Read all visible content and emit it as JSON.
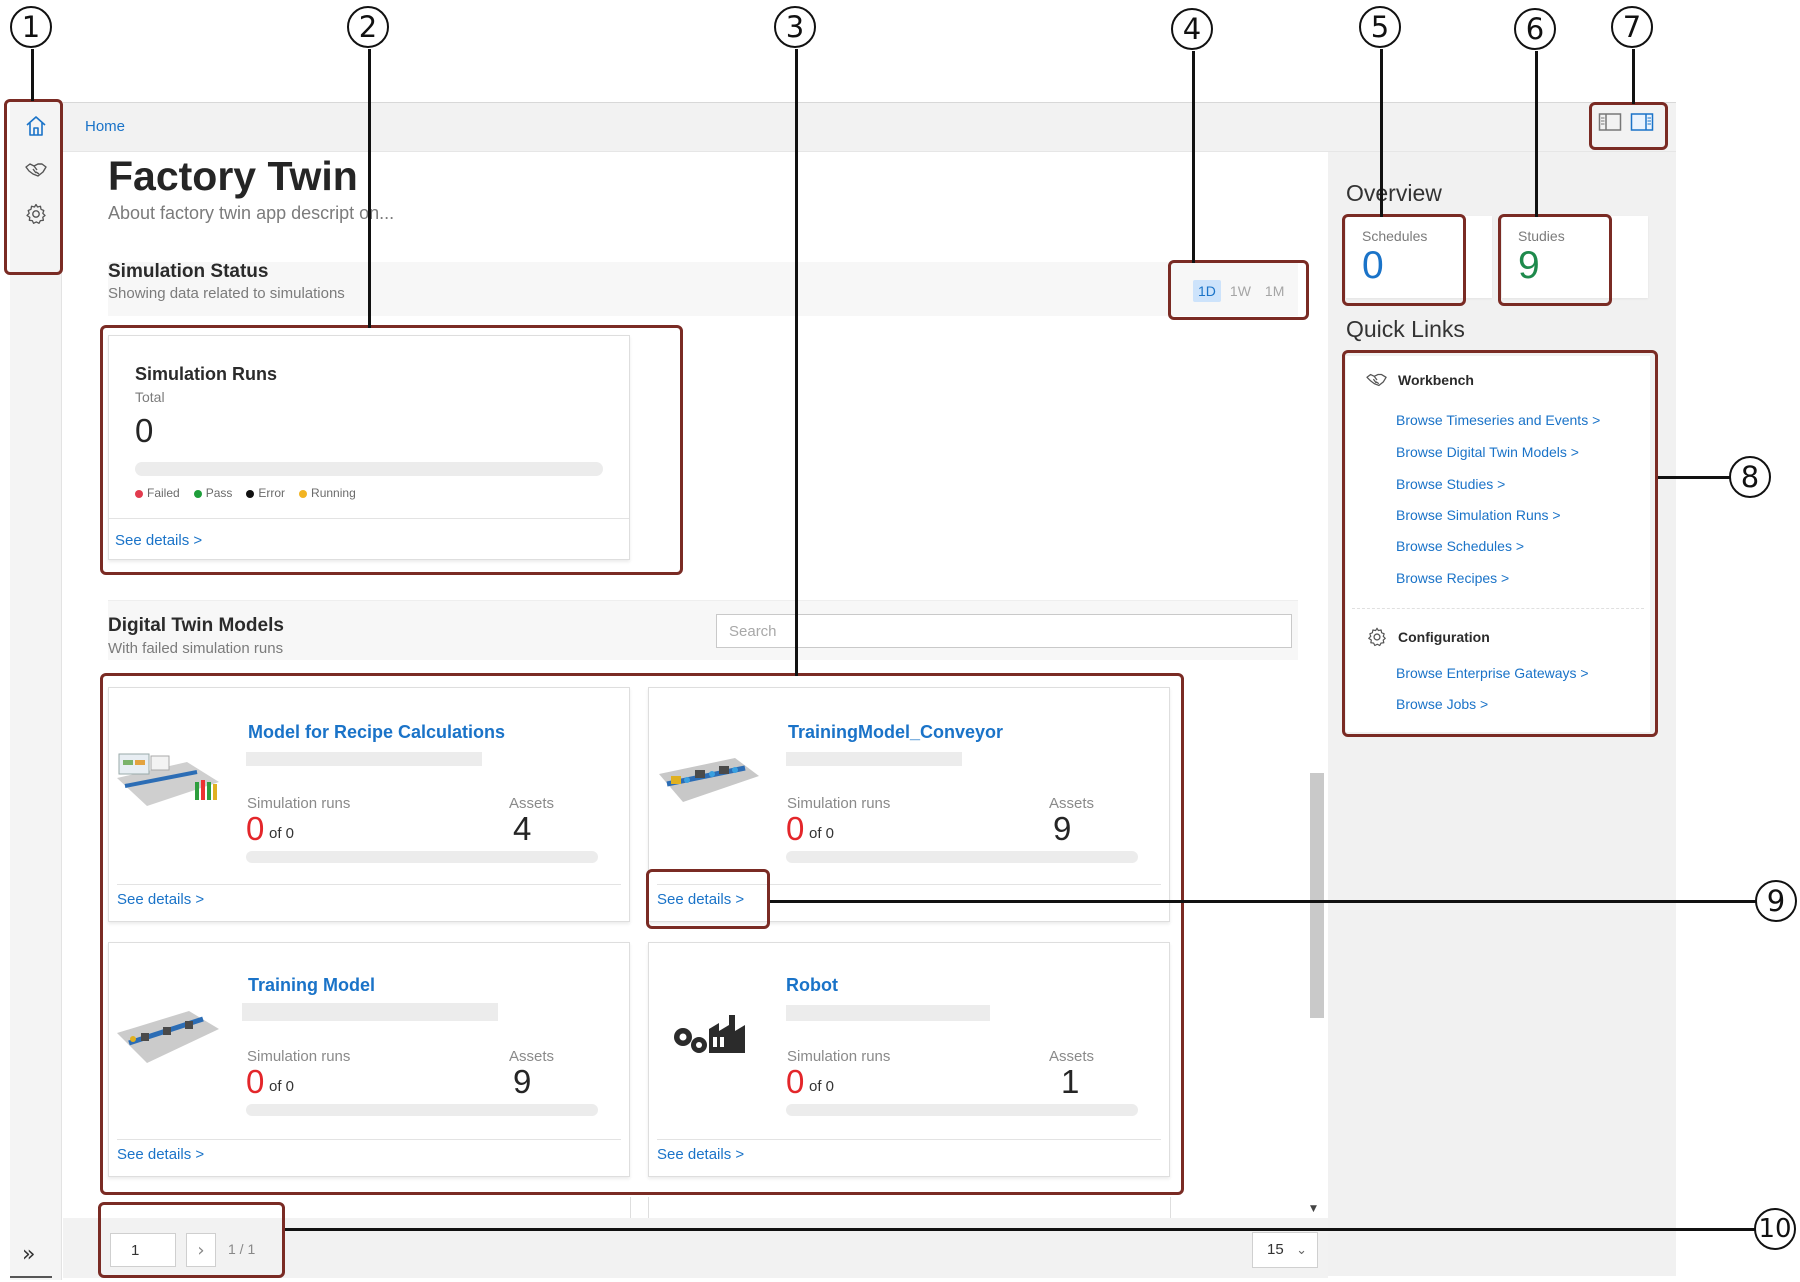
{
  "breadcrumb": {
    "home": "Home"
  },
  "page": {
    "title": "Factory Twin",
    "description": "About factory twin app descript on..."
  },
  "simulation_status": {
    "title": "Simulation Status",
    "subtitle": "Showing data related to simulations",
    "ranges": [
      "1D",
      "1W",
      "1M"
    ],
    "active_range": "1D"
  },
  "simulation_runs": {
    "title": "Simulation Runs",
    "label": "Total",
    "value": "0",
    "legend": [
      "Failed",
      "Pass",
      "Error",
      "Running"
    ],
    "legend_colors": [
      "#e23b4e",
      "#1e9e3a",
      "#111111",
      "#f2b422"
    ],
    "see_details": "See details >"
  },
  "models_section": {
    "title": "Digital Twin Models",
    "subtitle": "With failed simulation runs",
    "search_placeholder": "Search"
  },
  "models": [
    {
      "name": "Model for Recipe Calculations",
      "runs_label": "Simulation runs",
      "runs_failed": "0",
      "runs_total": "of 0",
      "assets_label": "Assets",
      "assets": "4",
      "see_details": "See details >",
      "thumb": "factory-line-screens-icon"
    },
    {
      "name": "TrainingModel_Conveyor",
      "runs_label": "Simulation runs",
      "runs_failed": "0",
      "runs_total": "of 0",
      "assets_label": "Assets",
      "assets": "9",
      "see_details": "See details >",
      "thumb": "conveyor-line-icon"
    },
    {
      "name": "Training Model",
      "runs_label": "Simulation runs",
      "runs_failed": "0",
      "runs_total": "of 0",
      "assets_label": "Assets",
      "assets": "9",
      "see_details": "See details >",
      "thumb": "conveyor-line-icon"
    },
    {
      "name": "Robot",
      "runs_label": "Simulation runs",
      "runs_failed": "0",
      "runs_total": "of 0",
      "assets_label": "Assets",
      "assets": "1",
      "see_details": "See details >",
      "thumb": "factory-gears-icon"
    }
  ],
  "pager": {
    "page": "1",
    "info": "1 / 1",
    "page_size": "15"
  },
  "overview": {
    "title": "Overview",
    "schedules_label": "Schedules",
    "schedules_value": "0",
    "studies_label": "Studies",
    "studies_value": "9",
    "schedules_color": "#1a73c8",
    "studies_color": "#1e8a4c"
  },
  "quick_links": {
    "title": "Quick Links",
    "workbench": {
      "label": "Workbench",
      "links": [
        "Browse Timeseries and Events >",
        "Browse Digital Twin Models >",
        "Browse Studies >",
        "Browse Simulation Runs >",
        "Browse Schedules >",
        "Browse Recipes >"
      ]
    },
    "configuration": {
      "label": "Configuration",
      "links": [
        "Browse Enterprise Gateways >",
        "Browse Jobs >"
      ]
    }
  },
  "callouts": [
    "1",
    "2",
    "3",
    "4",
    "5",
    "6",
    "7",
    "8",
    "9",
    "10"
  ],
  "colors": {
    "accent": "#1a73c8",
    "annotation": "#7a2b24",
    "error_red": "#e3262a"
  },
  "icons": {
    "home": "home-icon",
    "workbench": "handshake-icon",
    "settings": "gear-icon",
    "expand": "double-chevron-right-icon",
    "view_left": "panel-left-icon",
    "view_right": "panel-right-icon"
  }
}
